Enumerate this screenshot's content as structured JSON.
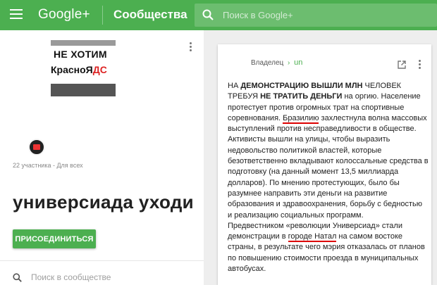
{
  "topbar": {
    "brand": "Google+",
    "section_title": "Сообщества",
    "search_placeholder": "Поиск в Google+"
  },
  "community": {
    "cover_line1": "НЕ ХОТИМ",
    "cover_line2_prefix": "КрасноЯ",
    "cover_line2_red": "ДС",
    "members_meta": "22 участника - Для всех",
    "name": "универсиада уходи",
    "join_label": "ПРИСОЕДИНИТЬСЯ",
    "search_placeholder": "Поиск в сообществе"
  },
  "post": {
    "owner_label": "Владелец",
    "separator": "›",
    "handle": "un",
    "p1_a": "НА ",
    "p1_b": "ДЕМОНСТРАЦИЮ ВЫШЛИ МЛН",
    "p1_c": " ЧЕЛОВЕК ТРЕБУЯ ",
    "p1_d": "НЕ ТРАТИТЬ ДЕНЬГИ",
    "p1_e": " на оргию. Население протестует против огромных трат на спортивные соревнования. ",
    "p1_mark": "Бразилию",
    "p1_f": " захлестнула волна массовых выступлений против несправедливости в обществе. Активисты вышли на улицы, чтобы выразить недовольство политикой властей, которые безответственно вкладывают колоссальные средства в подготовку (на данный момент 13,5 миллиарда долларов). По мнению протестующих, было бы разумнее направить эти деньги на развитие образования и здравоохранения, борьбу с бедностью и реализацию социальных программ.",
    "p2_a": "Предвестником «революции Универсиад» стали демонстрации в ",
    "p2_mark": "городе Натал",
    "p2_b": " на самом востоке страны, в результате чего мэрия отказалась от планов по повышению стоимости проезда в муниципальных автобусах."
  }
}
